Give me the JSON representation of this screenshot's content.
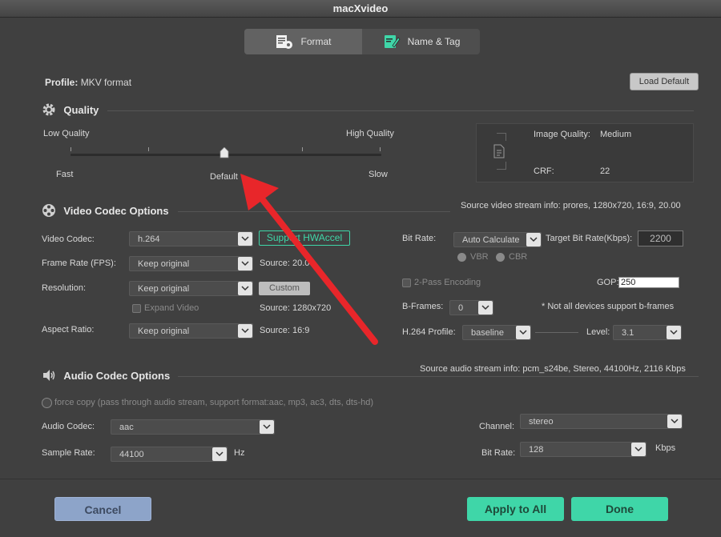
{
  "window": {
    "title": "macXvideo"
  },
  "tabs": [
    {
      "label": "Format",
      "icon": "format-settings-icon"
    },
    {
      "label": "Name & Tag",
      "icon": "edit-tag-icon"
    }
  ],
  "profile": {
    "label": "Profile:",
    "value": "MKV format",
    "load_default": "Load Default"
  },
  "quality": {
    "title": "Quality",
    "low": "Low Quality",
    "high": "High Quality",
    "fast": "Fast",
    "default": "Default",
    "slow": "Slow",
    "slider_level": 0.5,
    "image_quality_label": "Image Quality:",
    "image_quality_value": "Medium",
    "crf_label": "CRF:",
    "crf_value": "22"
  },
  "video": {
    "title": "Video Codec Options",
    "source_info": "Source video stream info: prores, 1280x720, 16:9, 20.00",
    "codec_label": "Video Codec:",
    "codec_value": "h.264",
    "hwaccel": "Support HWAccel",
    "framerate_label": "Frame Rate (FPS):",
    "framerate_value": "Keep original",
    "framerate_source": "Source: 20.00",
    "resolution_label": "Resolution:",
    "resolution_value": "Keep original",
    "custom": "Custom",
    "expand_video": "Expand Video",
    "resolution_source": "Source: 1280x720",
    "aspect_label": "Aspect Ratio:",
    "aspect_value": "Keep original",
    "aspect_source": "Source: 16:9",
    "bitrate_label": "Bit Rate:",
    "bitrate_value": "Auto Calculate",
    "target_label": "Target Bit Rate(Kbps):",
    "target_value": "2200",
    "vbr": "VBR",
    "cbr": "CBR",
    "twopass": "2-Pass Encoding",
    "gop_label": "GOP:",
    "gop_value": "250",
    "bframes_label": "B-Frames:",
    "bframes_value": "0",
    "bframes_note": "* Not all devices support b-frames",
    "profile_label": "H.264 Profile:",
    "profile_value": "baseline",
    "level_label": "Level:",
    "level_value": "3.1"
  },
  "audio": {
    "title": "Audio Codec Options",
    "source_info": "Source audio stream info: pcm_s24be, Stereo, 44100Hz, 2116 Kbps",
    "force_copy": "force copy (pass through audio stream, support format:aac, mp3, ac3, dts, dts-hd)",
    "codec_label": "Audio Codec:",
    "codec_value": "aac",
    "samplerate_label": "Sample Rate:",
    "samplerate_value": "44100",
    "hz": "Hz",
    "channel_label": "Channel:",
    "channel_value": "stereo",
    "bitrate_label": "Bit Rate:",
    "bitrate_value": "128",
    "kbps": "Kbps"
  },
  "footer": {
    "cancel": "Cancel",
    "apply_all": "Apply to All",
    "done": "Done"
  },
  "colors": {
    "accent_green": "#3fd6a8",
    "cancel_blue": "#8da4c9",
    "arrow_red": "#e8262a"
  }
}
